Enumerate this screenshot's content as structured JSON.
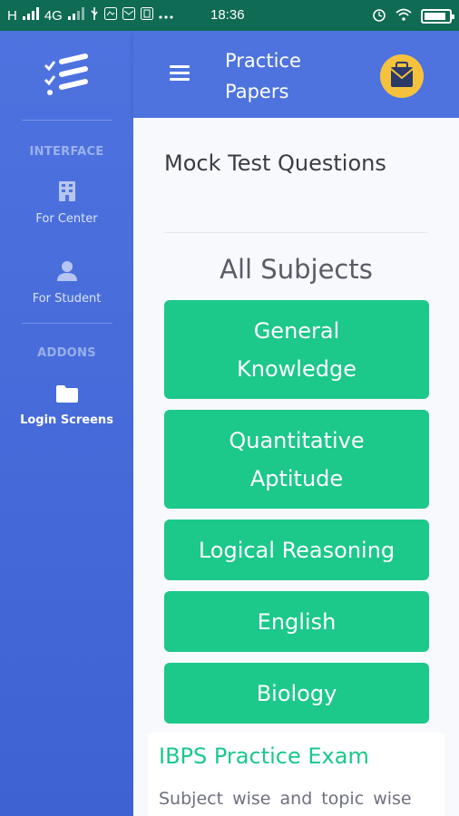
{
  "status_bar": {
    "carrier": "H",
    "network": "4G",
    "time": "18:36",
    "battery_level": 0.9
  },
  "sidebar": {
    "sections": [
      {
        "heading": "INTERFACE"
      },
      {
        "heading": "ADDONS"
      }
    ],
    "items": [
      {
        "label": "For Center",
        "icon": "building-icon"
      },
      {
        "label": "For Student",
        "icon": "user-icon"
      },
      {
        "label": "Login Screens",
        "icon": "folder-icon",
        "active": true
      }
    ]
  },
  "topbar": {
    "title": "Practice Papers"
  },
  "main": {
    "heading": "Mock Test Questions",
    "subjects_title": "All Subjects",
    "subjects": [
      {
        "label": "General Knowledge"
      },
      {
        "label": "Quantitative Aptitude"
      },
      {
        "label": "Logical Reasoning"
      },
      {
        "label": "English"
      },
      {
        "label": "Biology"
      }
    ],
    "card": {
      "title": "IBPS Practice Exam",
      "text": "Subject wise and topic wise"
    }
  },
  "colors": {
    "status_bar": "#0f6b54",
    "primary": "#4e73df",
    "success": "#1cc88a",
    "warning": "#f6c23e"
  }
}
